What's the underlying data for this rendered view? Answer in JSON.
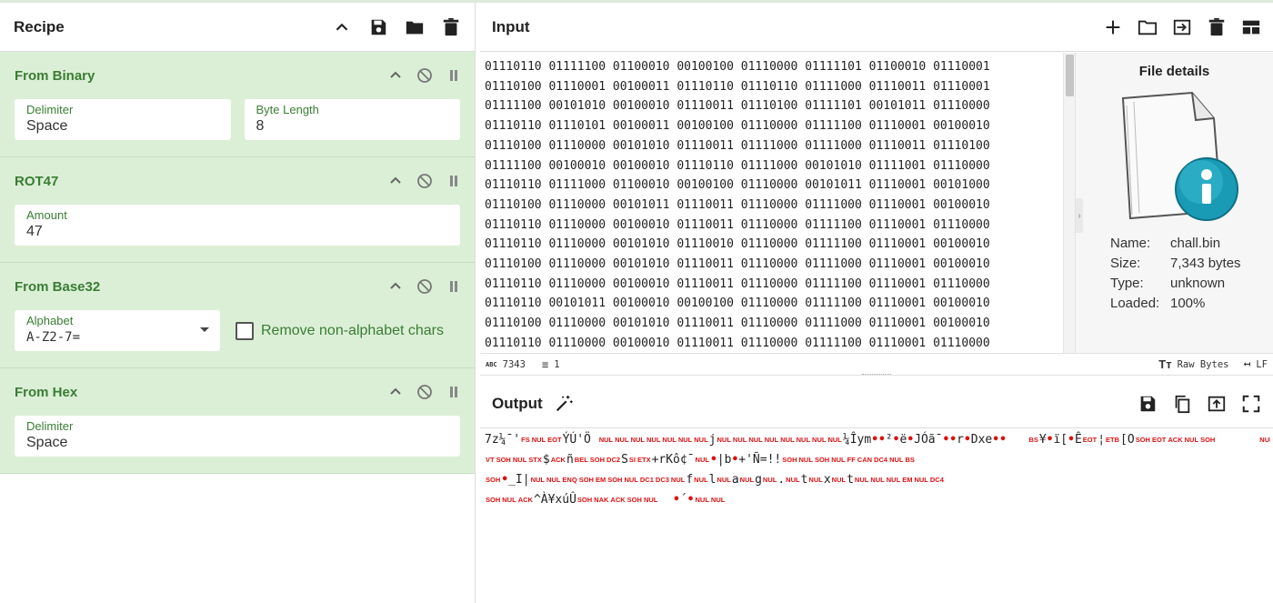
{
  "recipe": {
    "title": "Recipe",
    "operations": [
      {
        "name": "From Binary",
        "fields": [
          {
            "label": "Delimiter",
            "value": "Space"
          },
          {
            "label": "Byte Length",
            "value": "8"
          }
        ]
      },
      {
        "name": "ROT47",
        "fields": [
          {
            "label": "Amount",
            "value": "47"
          }
        ]
      },
      {
        "name": "From Base32",
        "fields": [
          {
            "label": "Alphabet",
            "value": "A-Z2-7="
          }
        ],
        "checkbox_label": "Remove non-alphabet chars"
      },
      {
        "name": "From Hex",
        "fields": [
          {
            "label": "Delimiter",
            "value": "Space"
          }
        ]
      }
    ]
  },
  "input": {
    "title": "Input",
    "lines": [
      "01110110 01111100 01100010 00100100 01110000 01111101 01100010 01110001",
      "01110100 01110001 00100011 01110110 01110110 01111000 01110011 01110001",
      "01111100 00101010 00100010 01110011 01110100 01111101 00101011 01110000",
      "01110110 01110101 00100011 00100100 01110000 01111100 01110001 00100010",
      "01110100 01110000 00101010 01110011 01111000 01111000 01110011 01110100",
      "01111100 00100010 00100010 01110110 01111000 00101010 01111001 01110000",
      "01110110 01111000 01100010 00100100 01110000 00101011 01110001 00101000",
      "01110100 01110000 00101011 01110011 01110000 01111000 01110001 00100010",
      "01110110 01110000 00100010 01110011 01110000 01111100 01110001 01110000",
      "01110110 01110000 00101010 01110010 01110000 01111100 01110001 00100010",
      "01110100 01110000 00101010 01110011 01110000 01111000 01110001 00100010",
      "01110110 01110000 00100010 01110011 01110000 01111100 01110001 01110000",
      "01110110 00101011 00100010 00100100 01110000 01111100 01110001 00100010",
      "01110100 01110000 00101010 01110011 01110000 01111000 01110001 00100010",
      "01110110 01110000 00100010 01110011 01110000 01111100 01110001 01110000"
    ]
  },
  "file_details": {
    "title": "File details",
    "rows": [
      {
        "key": "Name:",
        "value": "chall.bin"
      },
      {
        "key": "Size:",
        "value": "7,343 bytes"
      },
      {
        "key": "Type:",
        "value": "unknown"
      },
      {
        "key": "Loaded:",
        "value": "100%"
      }
    ]
  },
  "status_bar": {
    "length": "7343",
    "lines": "1",
    "encoding": "Raw Bytes",
    "eol": "LF"
  },
  "output": {
    "title": "Output",
    "line1": [
      {
        "t": "7z¼¯'"
      },
      {
        "c": "FS"
      },
      {
        "c": "NUL"
      },
      {
        "c": "EOT"
      },
      {
        "t": "ÝÚ'Ö "
      },
      {
        "c": "NUL"
      },
      {
        "c": "NUL"
      },
      {
        "c": "NUL"
      },
      {
        "c": "NUL"
      },
      {
        "c": "NUL"
      },
      {
        "c": "NUL"
      },
      {
        "c": "NUL"
      },
      {
        "t": "j"
      },
      {
        "c": "NUL"
      },
      {
        "c": "NUL"
      },
      {
        "c": "NUL"
      },
      {
        "c": "NUL"
      },
      {
        "c": "NUL"
      },
      {
        "c": "NUL"
      },
      {
        "c": "NUL"
      },
      {
        "c": "NUL"
      },
      {
        "t": "¼Îym"
      },
      {
        "d": "•"
      },
      {
        "d": "•"
      },
      {
        "t": "²"
      },
      {
        "d": "•"
      },
      {
        "t": "ë"
      },
      {
        "d": "•"
      },
      {
        "t": "JÓã¯"
      },
      {
        "d": "•"
      },
      {
        "d": "•"
      },
      {
        "t": "r"
      },
      {
        "d": "•"
      },
      {
        "t": "Dxe"
      },
      {
        "d": "•"
      },
      {
        "d": "•"
      },
      {
        "t": "   "
      },
      {
        "c": "BS"
      },
      {
        "t": "¥"
      },
      {
        "d": "•"
      },
      {
        "t": "ï["
      },
      {
        "d": "•"
      },
      {
        "t": "Ê"
      },
      {
        "c": "EOT"
      },
      {
        "t": "¦"
      },
      {
        "c": "ETB"
      },
      {
        "t": "[O"
      },
      {
        "c": "SOH"
      },
      {
        "c": "EOT"
      },
      {
        "c": "ACK"
      },
      {
        "c": "NUL"
      },
      {
        "c": "SOH"
      },
      {
        "t": "      "
      },
      {
        "c": "NUL"
      },
      {
        "c": "BEL"
      }
    ],
    "line2": [
      {
        "c": "VT"
      },
      {
        "c": "SOH"
      },
      {
        "c": "NUL"
      },
      {
        "c": "STX"
      },
      {
        "t": "$"
      },
      {
        "c": "ACK"
      },
      {
        "t": "ñ"
      },
      {
        "c": "BEL"
      },
      {
        "c": "SOH"
      },
      {
        "c": "DC2"
      },
      {
        "t": "S"
      },
      {
        "c": "SI"
      },
      {
        "c": "ETX"
      },
      {
        "t": "+rKô¢¯"
      },
      {
        "c": "NUL"
      },
      {
        "d": "•"
      },
      {
        "t": "|b"
      },
      {
        "d": "•"
      },
      {
        "t": "+'Ñ=!!"
      },
      {
        "c": "SOH"
      },
      {
        "c": "NUL"
      },
      {
        "c": "SOH"
      },
      {
        "c": "NUL"
      },
      {
        "c": "FF"
      },
      {
        "c": "CAN"
      },
      {
        "c": "DC4"
      },
      {
        "c": "NUL"
      },
      {
        "c": "BS"
      }
    ],
    "line3": [
      {
        "c": "SOH"
      },
      {
        "d": "•"
      },
      {
        "t": "_I|"
      },
      {
        "c": "NUL"
      },
      {
        "c": "NUL"
      },
      {
        "c": "ENQ"
      },
      {
        "c": "SOH"
      },
      {
        "c": "EM"
      },
      {
        "c": "SOH"
      },
      {
        "c": "NUL"
      },
      {
        "c": "DC1"
      },
      {
        "c": "DC3"
      },
      {
        "c": "NUL"
      },
      {
        "t": "f"
      },
      {
        "c": "NUL"
      },
      {
        "t": "l"
      },
      {
        "c": "NUL"
      },
      {
        "t": "a"
      },
      {
        "c": "NUL"
      },
      {
        "t": "g"
      },
      {
        "c": "NUL"
      },
      {
        "t": "."
      },
      {
        "c": "NUL"
      },
      {
        "t": "t"
      },
      {
        "c": "NUL"
      },
      {
        "t": "x"
      },
      {
        "c": "NUL"
      },
      {
        "t": "t"
      },
      {
        "c": "NUL"
      },
      {
        "c": "NUL"
      },
      {
        "c": "NUL"
      },
      {
        "c": "EM"
      },
      {
        "c": "NUL"
      },
      {
        "c": "DC4"
      }
    ],
    "line4": [
      {
        "c": "SOH"
      },
      {
        "c": "NUL"
      },
      {
        "c": "ACK"
      },
      {
        "t": "^À¥xúÛ"
      },
      {
        "c": "SOH"
      },
      {
        "c": "NAK"
      },
      {
        "c": "ACK"
      },
      {
        "c": "SOH"
      },
      {
        "c": "NUL"
      },
      {
        "t": "  "
      },
      {
        "d": "•"
      },
      {
        "t": "´"
      },
      {
        "d": "•"
      },
      {
        "c": "NUL"
      },
      {
        "c": "NUL"
      }
    ]
  },
  "colors": {
    "accent_green": "#3a7d34",
    "op_bg": "#dbefd6",
    "control_red": "#d11"
  }
}
